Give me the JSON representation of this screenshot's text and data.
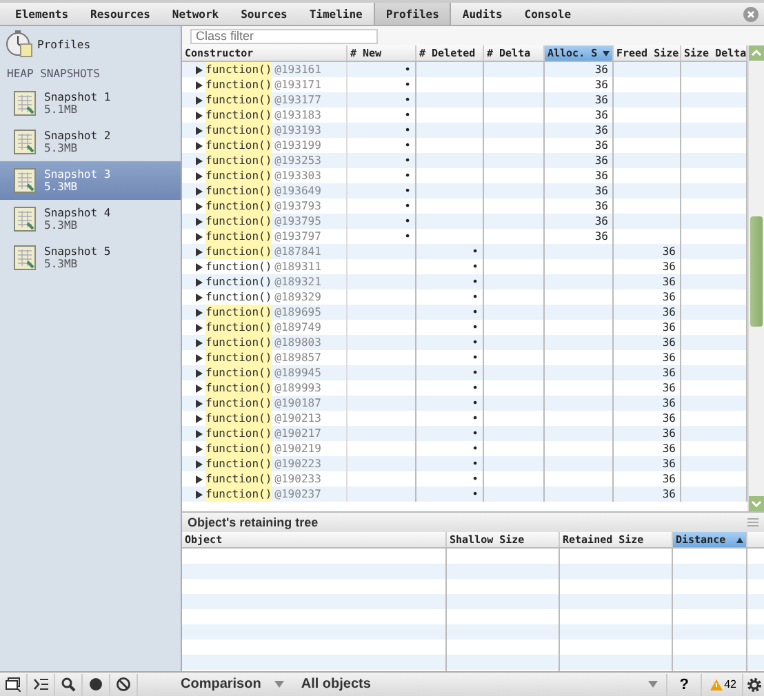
{
  "tabs": [
    {
      "label": "Elements",
      "selected": false
    },
    {
      "label": "Resources",
      "selected": false
    },
    {
      "label": "Network",
      "selected": false
    },
    {
      "label": "Sources",
      "selected": false
    },
    {
      "label": "Timeline",
      "selected": false
    },
    {
      "label": "Profiles",
      "selected": true
    },
    {
      "label": "Audits",
      "selected": false
    },
    {
      "label": "Console",
      "selected": false
    }
  ],
  "sidebar": {
    "title": "Profiles",
    "section": "HEAP SNAPSHOTS",
    "items": [
      {
        "name": "Snapshot 1",
        "size": "5.1MB",
        "selected": false
      },
      {
        "name": "Snapshot 2",
        "size": "5.3MB",
        "selected": false
      },
      {
        "name": "Snapshot 3",
        "size": "5.3MB",
        "selected": true
      },
      {
        "name": "Snapshot 4",
        "size": "5.3MB",
        "selected": false
      },
      {
        "name": "Snapshot 5",
        "size": "5.3MB",
        "selected": false
      }
    ]
  },
  "class_filter": {
    "placeholder": "Class filter"
  },
  "table": {
    "columns": [
      {
        "label": "Constructor",
        "sorted": false
      },
      {
        "label": "# New",
        "sorted": false
      },
      {
        "label": "# Deleted",
        "sorted": false
      },
      {
        "label": "# Delta",
        "sorted": false
      },
      {
        "label": "Alloc. S",
        "sorted": true,
        "ascending": false
      },
      {
        "label": "Freed Size",
        "sorted": false
      },
      {
        "label": "Size Delta",
        "sorted": false
      }
    ],
    "rows": [
      {
        "name": "function()",
        "id": "@193161",
        "highlighted": true,
        "new": "•",
        "alloc": "36"
      },
      {
        "name": "function()",
        "id": "@193171",
        "highlighted": true,
        "new": "•",
        "alloc": "36"
      },
      {
        "name": "function()",
        "id": "@193177",
        "highlighted": true,
        "new": "•",
        "alloc": "36"
      },
      {
        "name": "function()",
        "id": "@193183",
        "highlighted": true,
        "new": "•",
        "alloc": "36"
      },
      {
        "name": "function()",
        "id": "@193193",
        "highlighted": true,
        "new": "•",
        "alloc": "36"
      },
      {
        "name": "function()",
        "id": "@193199",
        "highlighted": true,
        "new": "•",
        "alloc": "36"
      },
      {
        "name": "function()",
        "id": "@193253",
        "highlighted": true,
        "new": "•",
        "alloc": "36"
      },
      {
        "name": "function()",
        "id": "@193303",
        "highlighted": true,
        "new": "•",
        "alloc": "36"
      },
      {
        "name": "function()",
        "id": "@193649",
        "highlighted": true,
        "new": "•",
        "alloc": "36"
      },
      {
        "name": "function()",
        "id": "@193793",
        "highlighted": true,
        "new": "•",
        "alloc": "36"
      },
      {
        "name": "function()",
        "id": "@193795",
        "highlighted": true,
        "new": "•",
        "alloc": "36"
      },
      {
        "name": "function()",
        "id": "@193797",
        "highlighted": true,
        "new": "•",
        "alloc": "36"
      },
      {
        "name": "function()",
        "id": "@187841",
        "highlighted": true,
        "deleted": "•",
        "freed": "36"
      },
      {
        "name": "function()",
        "id": "@189311",
        "highlighted": false,
        "deleted": "•",
        "freed": "36"
      },
      {
        "name": "function()",
        "id": "@189321",
        "highlighted": false,
        "deleted": "•",
        "freed": "36"
      },
      {
        "name": "function()",
        "id": "@189329",
        "highlighted": false,
        "deleted": "•",
        "freed": "36"
      },
      {
        "name": "function()",
        "id": "@189695",
        "highlighted": true,
        "deleted": "•",
        "freed": "36"
      },
      {
        "name": "function()",
        "id": "@189749",
        "highlighted": true,
        "deleted": "•",
        "freed": "36"
      },
      {
        "name": "function()",
        "id": "@189803",
        "highlighted": true,
        "deleted": "•",
        "freed": "36"
      },
      {
        "name": "function()",
        "id": "@189857",
        "highlighted": true,
        "deleted": "•",
        "freed": "36"
      },
      {
        "name": "function()",
        "id": "@189945",
        "highlighted": true,
        "deleted": "•",
        "freed": "36"
      },
      {
        "name": "function()",
        "id": "@189993",
        "highlighted": true,
        "deleted": "•",
        "freed": "36"
      },
      {
        "name": "function()",
        "id": "@190187",
        "highlighted": true,
        "deleted": "•",
        "freed": "36"
      },
      {
        "name": "function()",
        "id": "@190213",
        "highlighted": true,
        "deleted": "•",
        "freed": "36"
      },
      {
        "name": "function()",
        "id": "@190217",
        "highlighted": true,
        "deleted": "•",
        "freed": "36"
      },
      {
        "name": "function()",
        "id": "@190219",
        "highlighted": true,
        "deleted": "•",
        "freed": "36"
      },
      {
        "name": "function()",
        "id": "@190223",
        "highlighted": true,
        "deleted": "•",
        "freed": "36"
      },
      {
        "name": "function()",
        "id": "@190233",
        "highlighted": true,
        "deleted": "•",
        "freed": "36"
      },
      {
        "name": "function()",
        "id": "@190237",
        "highlighted": true,
        "deleted": "•",
        "freed": "36"
      }
    ]
  },
  "retaining_tree": {
    "title": "Object's retaining tree",
    "columns": [
      {
        "label": "Object",
        "sorted": false
      },
      {
        "label": "Shallow Size",
        "sorted": false
      },
      {
        "label": "Retained Size",
        "sorted": false
      },
      {
        "label": "Distance",
        "sorted": true,
        "ascending": true
      }
    ]
  },
  "status_bar": {
    "view": "Comparison",
    "filter": "All objects",
    "help": "?",
    "warnings": "42"
  }
}
